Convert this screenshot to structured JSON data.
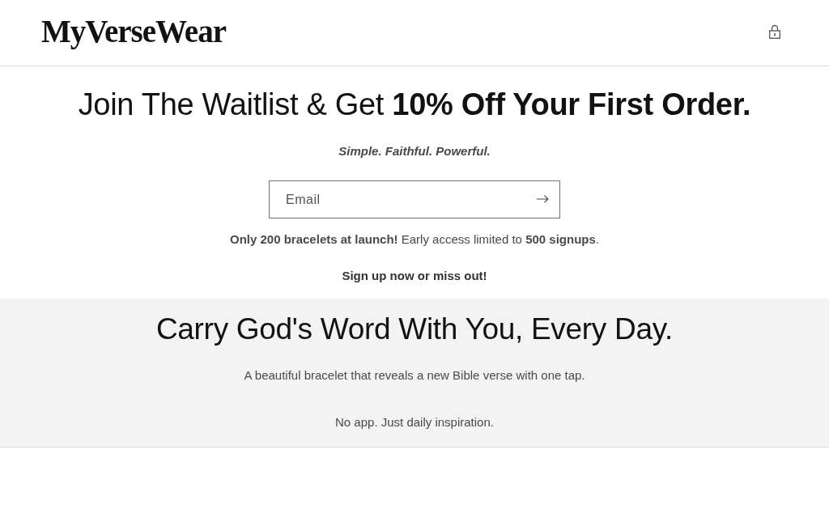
{
  "header": {
    "logo": "MyVerseWear"
  },
  "waitlist": {
    "heading": "Join The Waitlist & Get **10% Off Your First Order.**",
    "tagline": "Simple. Faithful. Powerful.",
    "email_field": {
      "placeholder": "Email"
    },
    "notice": "**Only 200 bracelets at launch!** Early access limited to **500 signups**.",
    "call_to_action": "Sign up now or miss out!"
  },
  "feature": {
    "heading": "Carry God's Word With You, Every Day.",
    "lines": [
      "A beautiful bracelet that reveals a new Bible verse with one tap.",
      "No app. Just daily inspiration."
    ]
  }
}
